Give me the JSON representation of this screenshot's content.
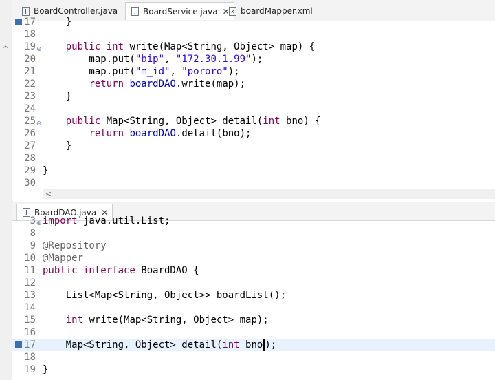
{
  "top_tabs": [
    {
      "label": "BoardController.java",
      "icon": "java-file-icon",
      "active": false
    },
    {
      "label": "BoardService.java",
      "icon": "java-file-icon",
      "active": true
    },
    {
      "label": "boardMapper.xml",
      "icon": "xml-file-icon",
      "active": false
    }
  ],
  "bottom_tabs": [
    {
      "label": "BoardDAO.java",
      "icon": "java-file-icon",
      "active": true
    }
  ],
  "top_code": [
    {
      "num": "17",
      "text": "    }"
    },
    {
      "num": "18",
      "text": ""
    },
    {
      "num": "19",
      "fold": true,
      "text": "    public int write(Map<String, Object> map) {"
    },
    {
      "num": "20",
      "text": "        map.put(\"bip\", \"172.30.1.99\");"
    },
    {
      "num": "21",
      "text": "        map.put(\"m_id\", \"pororo\");"
    },
    {
      "num": "22",
      "text": "        return boardDAO.write(map);"
    },
    {
      "num": "23",
      "text": "    }"
    },
    {
      "num": "24",
      "text": ""
    },
    {
      "num": "25",
      "fold": true,
      "text": "    public Map<String, Object> detail(int bno) {"
    },
    {
      "num": "26",
      "text": "        return boardDAO.detail(bno);"
    },
    {
      "num": "27",
      "text": "    }"
    },
    {
      "num": "28",
      "text": ""
    },
    {
      "num": "29",
      "text": "}"
    },
    {
      "num": "30",
      "text": ""
    }
  ],
  "bottom_code": [
    {
      "num": "3",
      "text": "import java.util.List;"
    },
    {
      "num": "8",
      "text": ""
    },
    {
      "num": "9",
      "text": "@Repository"
    },
    {
      "num": "10",
      "text": "@Mapper"
    },
    {
      "num": "11",
      "text": "public interface BoardDAO {"
    },
    {
      "num": "12",
      "text": ""
    },
    {
      "num": "13",
      "text": "    List<Map<String, Object>> boardList();"
    },
    {
      "num": "14",
      "text": ""
    },
    {
      "num": "15",
      "text": "    int write(Map<String, Object> map);"
    },
    {
      "num": "16",
      "text": ""
    },
    {
      "num": "17",
      "text": "    Map<String, Object> detail(int bno);"
    },
    {
      "num": "18",
      "text": ""
    },
    {
      "num": "19",
      "text": "}"
    }
  ],
  "scroll_left_glyph": "<",
  "collapse_glyph": "^"
}
